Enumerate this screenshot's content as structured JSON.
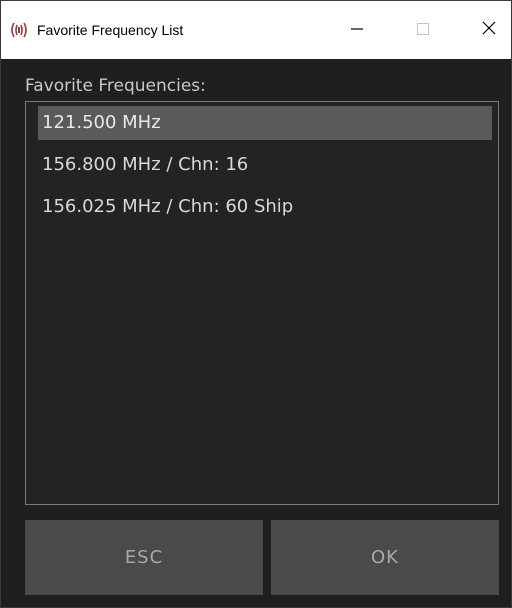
{
  "window": {
    "title": "Favorite Frequency List",
    "icon": "radio-waves-icon",
    "controls": {
      "minimize": "minimize-icon",
      "maximize": "maximize-icon",
      "close": "close-icon"
    }
  },
  "main": {
    "list_label": "Favorite Frequencies:",
    "items": [
      {
        "label": "121.500 MHz",
        "selected": true
      },
      {
        "label": "156.800 MHz / Chn: 16",
        "selected": false
      },
      {
        "label": "156.025 MHz / Chn: 60 Ship",
        "selected": false
      }
    ]
  },
  "buttons": {
    "esc_label": "ESC",
    "ok_label": "OK"
  },
  "colors": {
    "background": "#1f1f1f",
    "selection": "#5a5a5a",
    "button": "#4a4a4a",
    "text": "#d8d8d8"
  }
}
